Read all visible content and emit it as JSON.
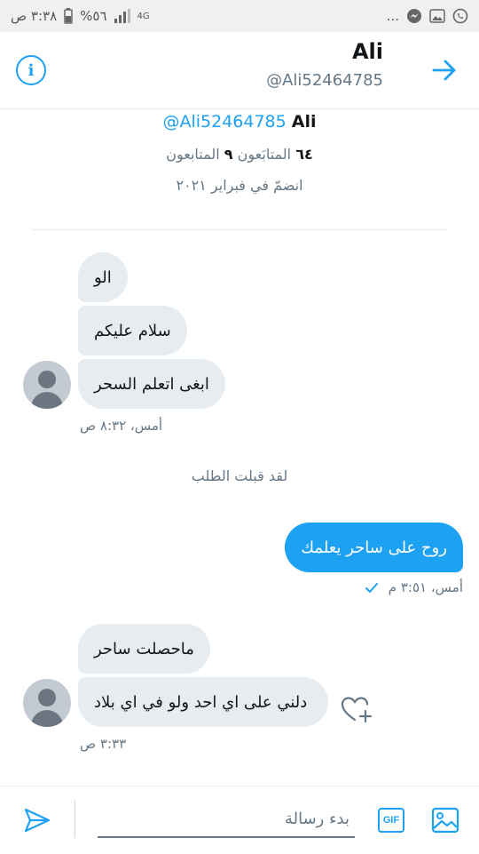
{
  "status_bar": {
    "time": "٣:٣٨ ص",
    "battery": "%٥٦",
    "network": "4G",
    "ellipsis": "..."
  },
  "header": {
    "title": "Ali",
    "handle": "@Ali52464785"
  },
  "profile": {
    "name": "Ali",
    "handle": "@Ali52464785",
    "following_count": "٦٤",
    "following_label": "المتابَعون",
    "followers_count": "٩",
    "followers_label": "المتابعون",
    "joined": "انضمّ في فبراير ٢٠٢١"
  },
  "messages": [
    {
      "text": "الو"
    },
    {
      "text": "سلام عليكم"
    },
    {
      "text": "ابغى اتعلم السحر"
    },
    {
      "text": "روح على ساحر يعلمك"
    },
    {
      "text": "ماحصلت ساحر"
    },
    {
      "text": "دلني على اي احد ولو في اي بلاد"
    }
  ],
  "meta": {
    "group1_time": "أمس، ٨:٣٢ ص",
    "accepted_notice": "لقد قبلت الطلب",
    "sent_time": "أمس، ٣:٥١ م",
    "group2_time": "٣:٣٣ ص"
  },
  "composer": {
    "placeholder": "بدء رسالة",
    "gif_label": "GIF"
  },
  "colors": {
    "accent": "#1da1f2",
    "bubble_in": "#e6ecf0",
    "muted": "#657786"
  }
}
